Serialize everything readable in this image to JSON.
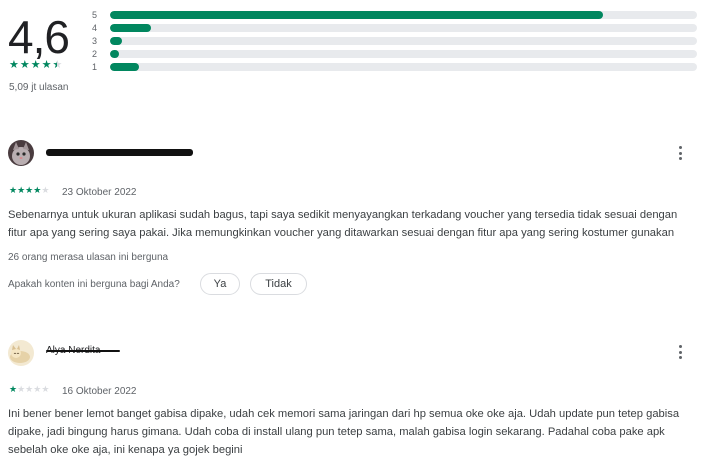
{
  "summary": {
    "rating": "4,6",
    "stars": 4.5,
    "review_count": "5,09 jt ulasan",
    "histogram": [
      {
        "label": "5",
        "fraction": 0.84
      },
      {
        "label": "4",
        "fraction": 0.07
      },
      {
        "label": "3",
        "fraction": 0.02
      },
      {
        "label": "2",
        "fraction": 0.01
      },
      {
        "label": "1",
        "fraction": 0.05
      }
    ],
    "accent_color": "#01875f"
  },
  "reviews": [
    {
      "name": "",
      "name_redacted": true,
      "avatar": "cat-avatar",
      "stars": 4,
      "date": "23 Oktober 2022",
      "text_lines": [
        "Sebenarnya untuk ukuran aplikasi sudah bagus, tapi saya sedikit menyayangkan terkadang voucher yang tersedia tidak sesuai dengan",
        "fitur apa yang sering saya pakai. Jika memungkinkan voucher yang ditawarkan sesuai dengan fitur apa yang sering kostumer gunakan"
      ],
      "helpful_count": "26 orang merasa ulasan ini berguna",
      "helpful_question": "Apakah konten ini berguna bagi Anda?",
      "yes_label": "Ya",
      "no_label": "Tidak"
    },
    {
      "name": "Alya Nerdita",
      "name_redacted": true,
      "avatar": "cat-avatar",
      "stars": 1,
      "date": "16 Oktober 2022",
      "text_lines": [
        "Ini bener bener lemot banget gabisa dipake, udah cek memori sama jaringan dari hp semua oke oke aja. Udah update pun tetep gabisa",
        "dipake, jadi bingung harus gimana. Udah coba di install ulang pun tetep sama, malah gabisa login sekarang. Padahal coba pake apk",
        "sebelah oke oke aja, ini kenapa ya gojek begini"
      ]
    }
  ]
}
